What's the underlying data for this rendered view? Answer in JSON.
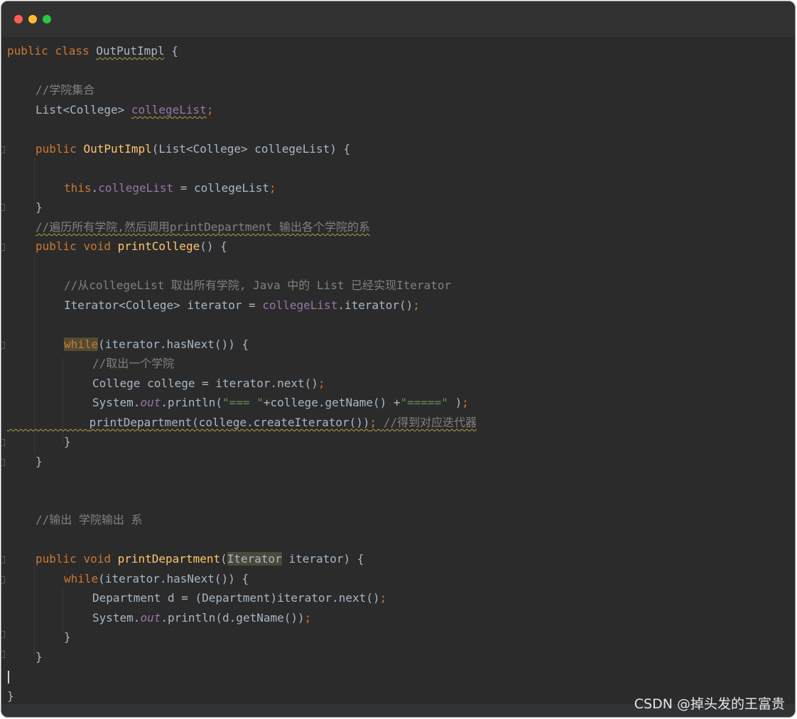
{
  "window": {
    "controls": [
      "close",
      "minimize",
      "zoom"
    ]
  },
  "code": {
    "l1": {
      "a": "public",
      "b": " ",
      "c": "class",
      "d": " ",
      "e": "OutPutImpl",
      "f": " {"
    },
    "l3": "//学院集合",
    "l4": {
      "a": "List<College> ",
      "b": "collegeList",
      "c": ";"
    },
    "l6": {
      "a": "public",
      "b": " ",
      "c": "OutPutImpl",
      "d": "(List<College> collegeList) {"
    },
    "l8": {
      "a": "this",
      "b": ".",
      "c": "collegeList",
      "d": " = collegeList",
      "e": ";"
    },
    "l9": "}",
    "l10": "//遍历所有学院,然后调用printDepartment 输出各个学院的系",
    "l11": {
      "a": "public",
      "b": " ",
      "c": "void",
      "d": " ",
      "e": "printCollege",
      "f": "() {"
    },
    "l13": "//从collegeList 取出所有学院, Java 中的 List 已经实现Iterator",
    "l14": {
      "a": "Iterator<College> iterator = ",
      "b": "collegeList",
      "c": ".iterator()",
      "d": ";"
    },
    "l16": {
      "a": "while",
      "b": "(iterator.hasNext()) {"
    },
    "l17": "//取出一个学院",
    "l18": {
      "a": "College college = iterator.next()",
      "b": ";"
    },
    "l19": {
      "a": "System.",
      "b": "out",
      "c": ".println(",
      "d": "\"=== \"",
      "e": "+college.getName() +",
      "f": "\"=====\"",
      "g": " )",
      "h": ";"
    },
    "l20": {
      "a": "printDepartment(college.createIterator())",
      "b": "; ",
      "c": "//得到对应迭代器"
    },
    "l21": "}",
    "l22": "}",
    "l25": "//输出 学院输出 系",
    "l27": {
      "a": "public",
      "b": " ",
      "c": "void",
      "d": " ",
      "e": "printDepartment",
      "f": "(",
      "g": "Iterator",
      "h": " iterator) {"
    },
    "l28": {
      "a": "while",
      "b": "(iterator.hasNext()) {"
    },
    "l29": {
      "a": "Department d = (Department)iterator.next()",
      "b": ";"
    },
    "l30": {
      "a": "System.",
      "b": "out",
      "c": ".println(d.getName())",
      "d": ";"
    },
    "l31": "}",
    "l32": "}",
    "l34": "}"
  },
  "watermark": "CSDN @掉头发的王富贵"
}
